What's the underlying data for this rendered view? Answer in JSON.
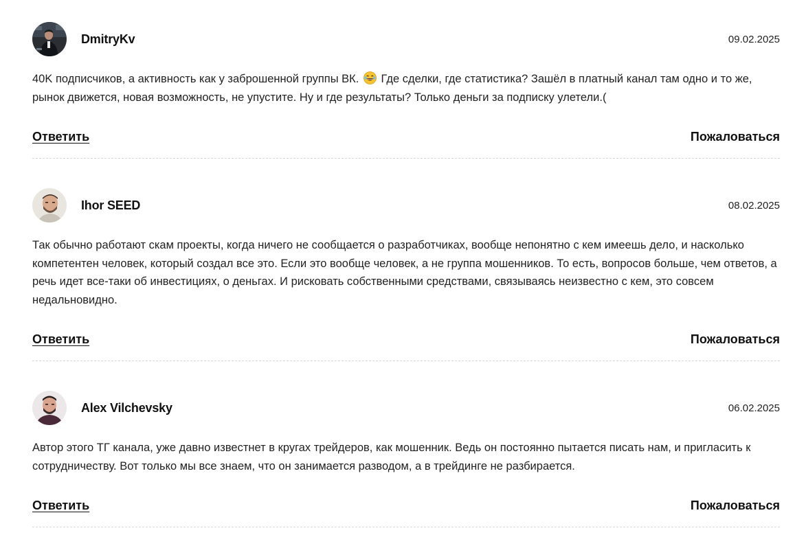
{
  "comments": [
    {
      "author": "DmitryKv",
      "date": "09.02.2025",
      "text_before_emoji": "40K подписчиков, а активность как у заброшенной группы ВК.",
      "text_after_emoji": "Где сделки, где статистика? Зашёл в платный канал там одно и то же, рынок движется, новая возможность, не упустите. Ну и где результаты? Только деньги за подписку улетели.(",
      "emoji": "laughing-tears-emoji",
      "reply_label": "Ответить",
      "report_label": "Пожаловаться"
    },
    {
      "author": "Ihor SEED",
      "date": "08.02.2025",
      "text": "Так обычно работают скам проекты, когда ничего не сообщается о разработчиках, вообще непонятно с кем имеешь дело, и насколько компетентен человек, который создал все это. Если это вообще человек, а не группа мошенников. То есть, вопросов больше, чем ответов, а речь идет все-таки об инвестициях, о деньгах. И рисковать собственными средствами, связываясь неизвестно с кем, это совсем недальновидно.",
      "reply_label": "Ответить",
      "report_label": "Пожаловаться"
    },
    {
      "author": "Alex Vilchevsky",
      "date": "06.02.2025",
      "text": "Автор этого ТГ канала, уже давно известнет в кругах трейдеров, как мошенник. Ведь он постоянно пытается писать нам, и пригласить к сотрудничеству. Вот только мы все знаем, что он занимается разводом, а в трейдинге не разбирается.",
      "reply_label": "Ответить",
      "report_label": "Пожаловаться"
    }
  ],
  "colors": {
    "text": "#1a1a1a",
    "divider": "#d9d9d9",
    "background": "#ffffff"
  }
}
